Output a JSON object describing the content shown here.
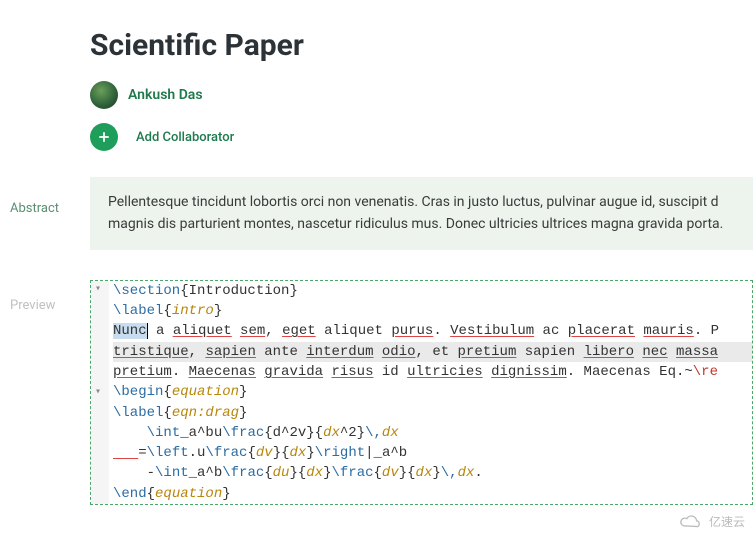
{
  "title": "Scientific Paper",
  "author": {
    "name": "Ankush Das"
  },
  "add_collaborator_label": "Add Collaborator",
  "sidebar": {
    "abstract_label": "Abstract",
    "preview_label": "Preview"
  },
  "abstract_text": "Pellentesque tincidunt lobortis orci non venenatis. Cras in justo luctus, pulvinar augue id, suscipit d magnis dis parturient montes, nascetur ridiculus mus. Donec ultricies ultrices magna gravida porta.",
  "editor": {
    "lines": [
      {
        "type": "section",
        "cmd": "\\section",
        "arg": "Introduction"
      },
      {
        "type": "label",
        "cmd": "\\label",
        "arg": "intro"
      },
      {
        "type": "text",
        "raw": "Nunc a aliquet sem, eget aliquet purus. Vestibulum ac placerat mauris. P",
        "selection": "Nunc",
        "underlined": [
          "aliquet",
          "sem",
          "eget",
          "aliquet",
          "purus",
          "Vestibulum",
          "placerat",
          "mauris"
        ]
      },
      {
        "type": "text",
        "raw": "tristique, sapien ante interdum odio, et pretium sapien libero nec massa",
        "underlined": [
          "tristique",
          "sapien",
          "interdum",
          "odio",
          "pretium",
          "sapien",
          "libero",
          "nec",
          "massa"
        ]
      },
      {
        "type": "text",
        "raw": "pretium. Maecenas gravida risus id ultricies dignissim. Maecenas Eq.~\\re",
        "underlined": [
          "pretium",
          "Maecenas",
          "gravida",
          "risus",
          "ultricies",
          "dignissim",
          "Maecenas"
        ]
      },
      {
        "type": "begin",
        "cmd": "\\begin",
        "arg": "equation"
      },
      {
        "type": "label",
        "cmd": "\\label",
        "arg": "eqn:drag"
      },
      {
        "type": "math",
        "raw": "    \\int_a^bu\\frac{d^2v}{dx^2}\\,dx"
      },
      {
        "type": "math",
        "raw": "   =\\left.u\\frac{dv}{dx}\\right|_a^b",
        "leading_underline": true
      },
      {
        "type": "math",
        "raw": "    -\\int_a^b\\frac{du}{dx}\\frac{dv}{dx}\\,dx."
      },
      {
        "type": "end",
        "cmd": "\\end",
        "arg": "equation"
      }
    ]
  },
  "watermark": "亿速云"
}
